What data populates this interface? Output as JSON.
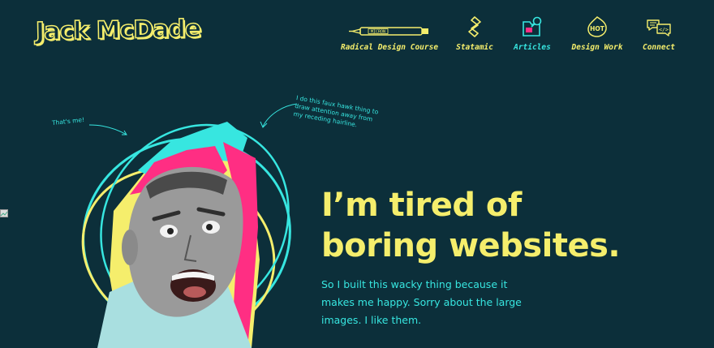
{
  "header": {
    "logo_text": "Jack McDade"
  },
  "nav": {
    "items": [
      {
        "label": "Radical Design Course",
        "icon": "micron-pen-icon",
        "color": "#f5ee6c"
      },
      {
        "label": "Statamic",
        "icon": "statamic-icon",
        "color": "#f5ee6c"
      },
      {
        "label": "Articles",
        "icon": "folder-magnify-icon",
        "color": "#37e6e0"
      },
      {
        "label": "Design Work",
        "icon": "hot-icon",
        "color": "#f5ee6c"
      },
      {
        "label": "Connect",
        "icon": "speech-bubbles-icon",
        "color": "#f5ee6c"
      }
    ],
    "pen_text": "MICRON",
    "hot_text": "HOT"
  },
  "annotations": {
    "thats_me": "That's me!",
    "faux_hawk": [
      "I do this faux hawk thing to",
      "draw attention away from",
      "my receding hairline."
    ]
  },
  "hero": {
    "headline_line1": "I’m tired of",
    "headline_line2": "boring websites.",
    "sub_line1": "So I built this wacky thing because it",
    "sub_line2": "makes me happy. Sorry about the large",
    "sub_line3": "images. I like them."
  },
  "colors": {
    "background": "#0c2f3a",
    "yellow": "#f5ee6c",
    "cyan": "#37e6e0",
    "pink": "#ff2e83"
  }
}
